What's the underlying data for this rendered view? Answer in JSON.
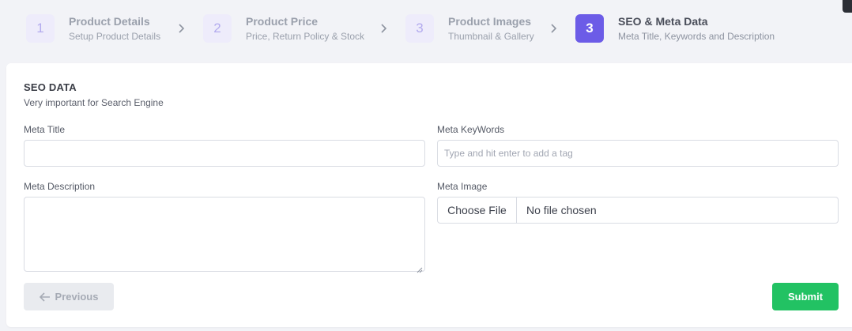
{
  "stepper": {
    "steps": [
      {
        "number": "1",
        "title": "Product Details",
        "subtitle": "Setup Product Details"
      },
      {
        "number": "2",
        "title": "Product Price",
        "subtitle": "Price, Return Policy & Stock"
      },
      {
        "number": "3",
        "title": "Product Images",
        "subtitle": "Thumbnail & Gallery"
      },
      {
        "number": "3",
        "title": "SEO & Meta Data",
        "subtitle": "Meta Title, Keywords and Description"
      }
    ],
    "active_step_index": 3,
    "active_color": "#6c5ce7"
  },
  "form": {
    "section_title": "SEO DATA",
    "section_subtitle": "Very important for Search Engine",
    "meta_title": {
      "label": "Meta Title",
      "value": ""
    },
    "meta_keywords": {
      "label": "Meta KeyWords",
      "placeholder": "Type and hit enter to add a tag"
    },
    "meta_description": {
      "label": "Meta Description",
      "value": ""
    },
    "meta_image": {
      "label": "Meta Image",
      "button_label": "Choose File",
      "status": "No file chosen"
    }
  },
  "actions": {
    "previous_label": "Previous",
    "submit_label": "Submit",
    "submit_color": "#22c263"
  },
  "icons": [
    "chevron-right-icon",
    "arrow-left-icon",
    "resize-grip-icon"
  ]
}
